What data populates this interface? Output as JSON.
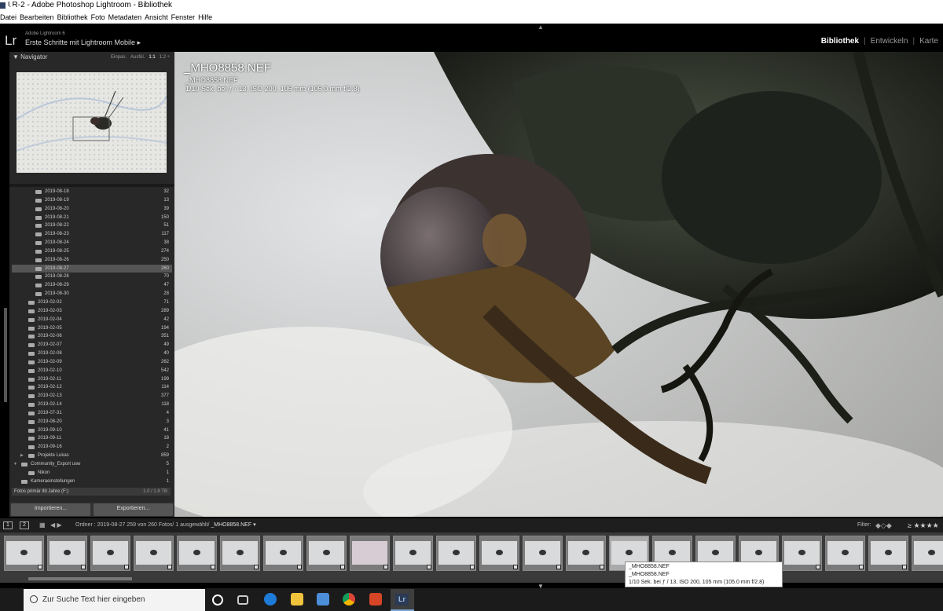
{
  "window": {
    "title": "LR-2 - Adobe Photoshop Lightroom - Bibliothek"
  },
  "menu": [
    "Datei",
    "Bearbeiten",
    "Bibliothek",
    "Foto",
    "Metadaten",
    "Ansicht",
    "Fenster",
    "Hilfe"
  ],
  "identity": {
    "logo": "Lr",
    "product": "Adobe Lightroom 6",
    "plate": "Erste Schritte mit Lightroom Mobile ▸"
  },
  "modules": {
    "library": "Bibliothek",
    "develop": "Entwickeln",
    "map": "Karte",
    "sep": "|"
  },
  "navigator": {
    "title": "Navigator",
    "opts": [
      "Einpas.",
      "Ausfül.",
      "1:1",
      "1:2 ÷"
    ]
  },
  "folders": [
    {
      "label": "2019-08-18",
      "count": "32",
      "indent": 2
    },
    {
      "label": "2019-08-19",
      "count": "13",
      "indent": 2
    },
    {
      "label": "2019-08-20",
      "count": "39",
      "indent": 2
    },
    {
      "label": "2019-08-21",
      "count": "150",
      "indent": 2
    },
    {
      "label": "2019-08-22",
      "count": "51",
      "indent": 2
    },
    {
      "label": "2019-08-23",
      "count": "117",
      "indent": 2
    },
    {
      "label": "2019-08-24",
      "count": "38",
      "indent": 2
    },
    {
      "label": "2019-08-25",
      "count": "274",
      "indent": 2
    },
    {
      "label": "2019-08-26",
      "count": "250",
      "indent": 2
    },
    {
      "label": "2019-08-27",
      "count": "260",
      "indent": 2,
      "selected": true
    },
    {
      "label": "2019-08-28",
      "count": "70",
      "indent": 2
    },
    {
      "label": "2019-08-29",
      "count": "47",
      "indent": 2
    },
    {
      "label": "2019-08-30",
      "count": "28",
      "indent": 2
    },
    {
      "label": "2019-02-02",
      "count": "71",
      "indent": 1
    },
    {
      "label": "2019-02-03",
      "count": "289",
      "indent": 1
    },
    {
      "label": "2019-02-04",
      "count": "42",
      "indent": 1
    },
    {
      "label": "2019-02-05",
      "count": "194",
      "indent": 1
    },
    {
      "label": "2019-02-06",
      "count": "351",
      "indent": 1
    },
    {
      "label": "2019-02-07",
      "count": "49",
      "indent": 1
    },
    {
      "label": "2019-02-08",
      "count": "40",
      "indent": 1
    },
    {
      "label": "2019-02-09",
      "count": "262",
      "indent": 1
    },
    {
      "label": "2019-02-10",
      "count": "542",
      "indent": 1
    },
    {
      "label": "2019-02-11",
      "count": "199",
      "indent": 1
    },
    {
      "label": "2019-02-12",
      "count": "114",
      "indent": 1
    },
    {
      "label": "2019-02-13",
      "count": "377",
      "indent": 1
    },
    {
      "label": "2019-02-14",
      "count": "118",
      "indent": 1
    },
    {
      "label": "2019-07-31",
      "count": "4",
      "indent": 1
    },
    {
      "label": "2019-08-20",
      "count": "3",
      "indent": 1
    },
    {
      "label": "2019-09-10",
      "count": "41",
      "indent": 1
    },
    {
      "label": "2019-09-11",
      "count": "18",
      "indent": 1
    },
    {
      "label": "2019-09-16",
      "count": "2",
      "indent": 1
    },
    {
      "label": "Projekte Lukas",
      "count": "859",
      "indent": 1,
      "tri": "▶"
    },
    {
      "label": "Community_Export usw",
      "count": "5",
      "indent": 0,
      "tri": "▼"
    },
    {
      "label": "Nikon",
      "count": "1",
      "indent": 1
    },
    {
      "label": "Kameraeinstellungen",
      "count": "1",
      "indent": 0
    }
  ],
  "drive": {
    "label": "Fotos primär ifd Jahre (F:)",
    "size": "1.0 / 1.8 TB"
  },
  "buttons": {
    "import": "Importieren...",
    "export": "Exportieren..."
  },
  "overlay": {
    "name": "_MHO8858.NEF",
    "file": "_MHO8858.NEF",
    "exposure": "1/10 Sek. bei ƒ / 13, ISO 200, 105 mm (105.0 mm f/2.8)"
  },
  "filmbar": {
    "view1": "1",
    "view2": "2",
    "path": "Ordner : 2019-08-27   259 von 260 Fotos/ 1 ausgewählt/ ",
    "file": "_MHO8858.NEF ▾",
    "filter": "Filter:",
    "stars": "≥ ★★★★"
  },
  "filmstrip": {
    "count": 22,
    "selected_index": 14,
    "blur_index": 8
  },
  "tooltip": {
    "line1": "_MHO8858.NEF",
    "line2": "_MHO8858.NEF",
    "line3": "1/10 Sek. bei ƒ / 13, ISO 200, 105 mm (105.0 mm f/2.8)"
  },
  "taskbar": {
    "search": "Zur Suche Text hier eingeben"
  },
  "colors": {
    "accent": "#7aa7d8",
    "panel": "#282828",
    "selected": "#555555"
  }
}
